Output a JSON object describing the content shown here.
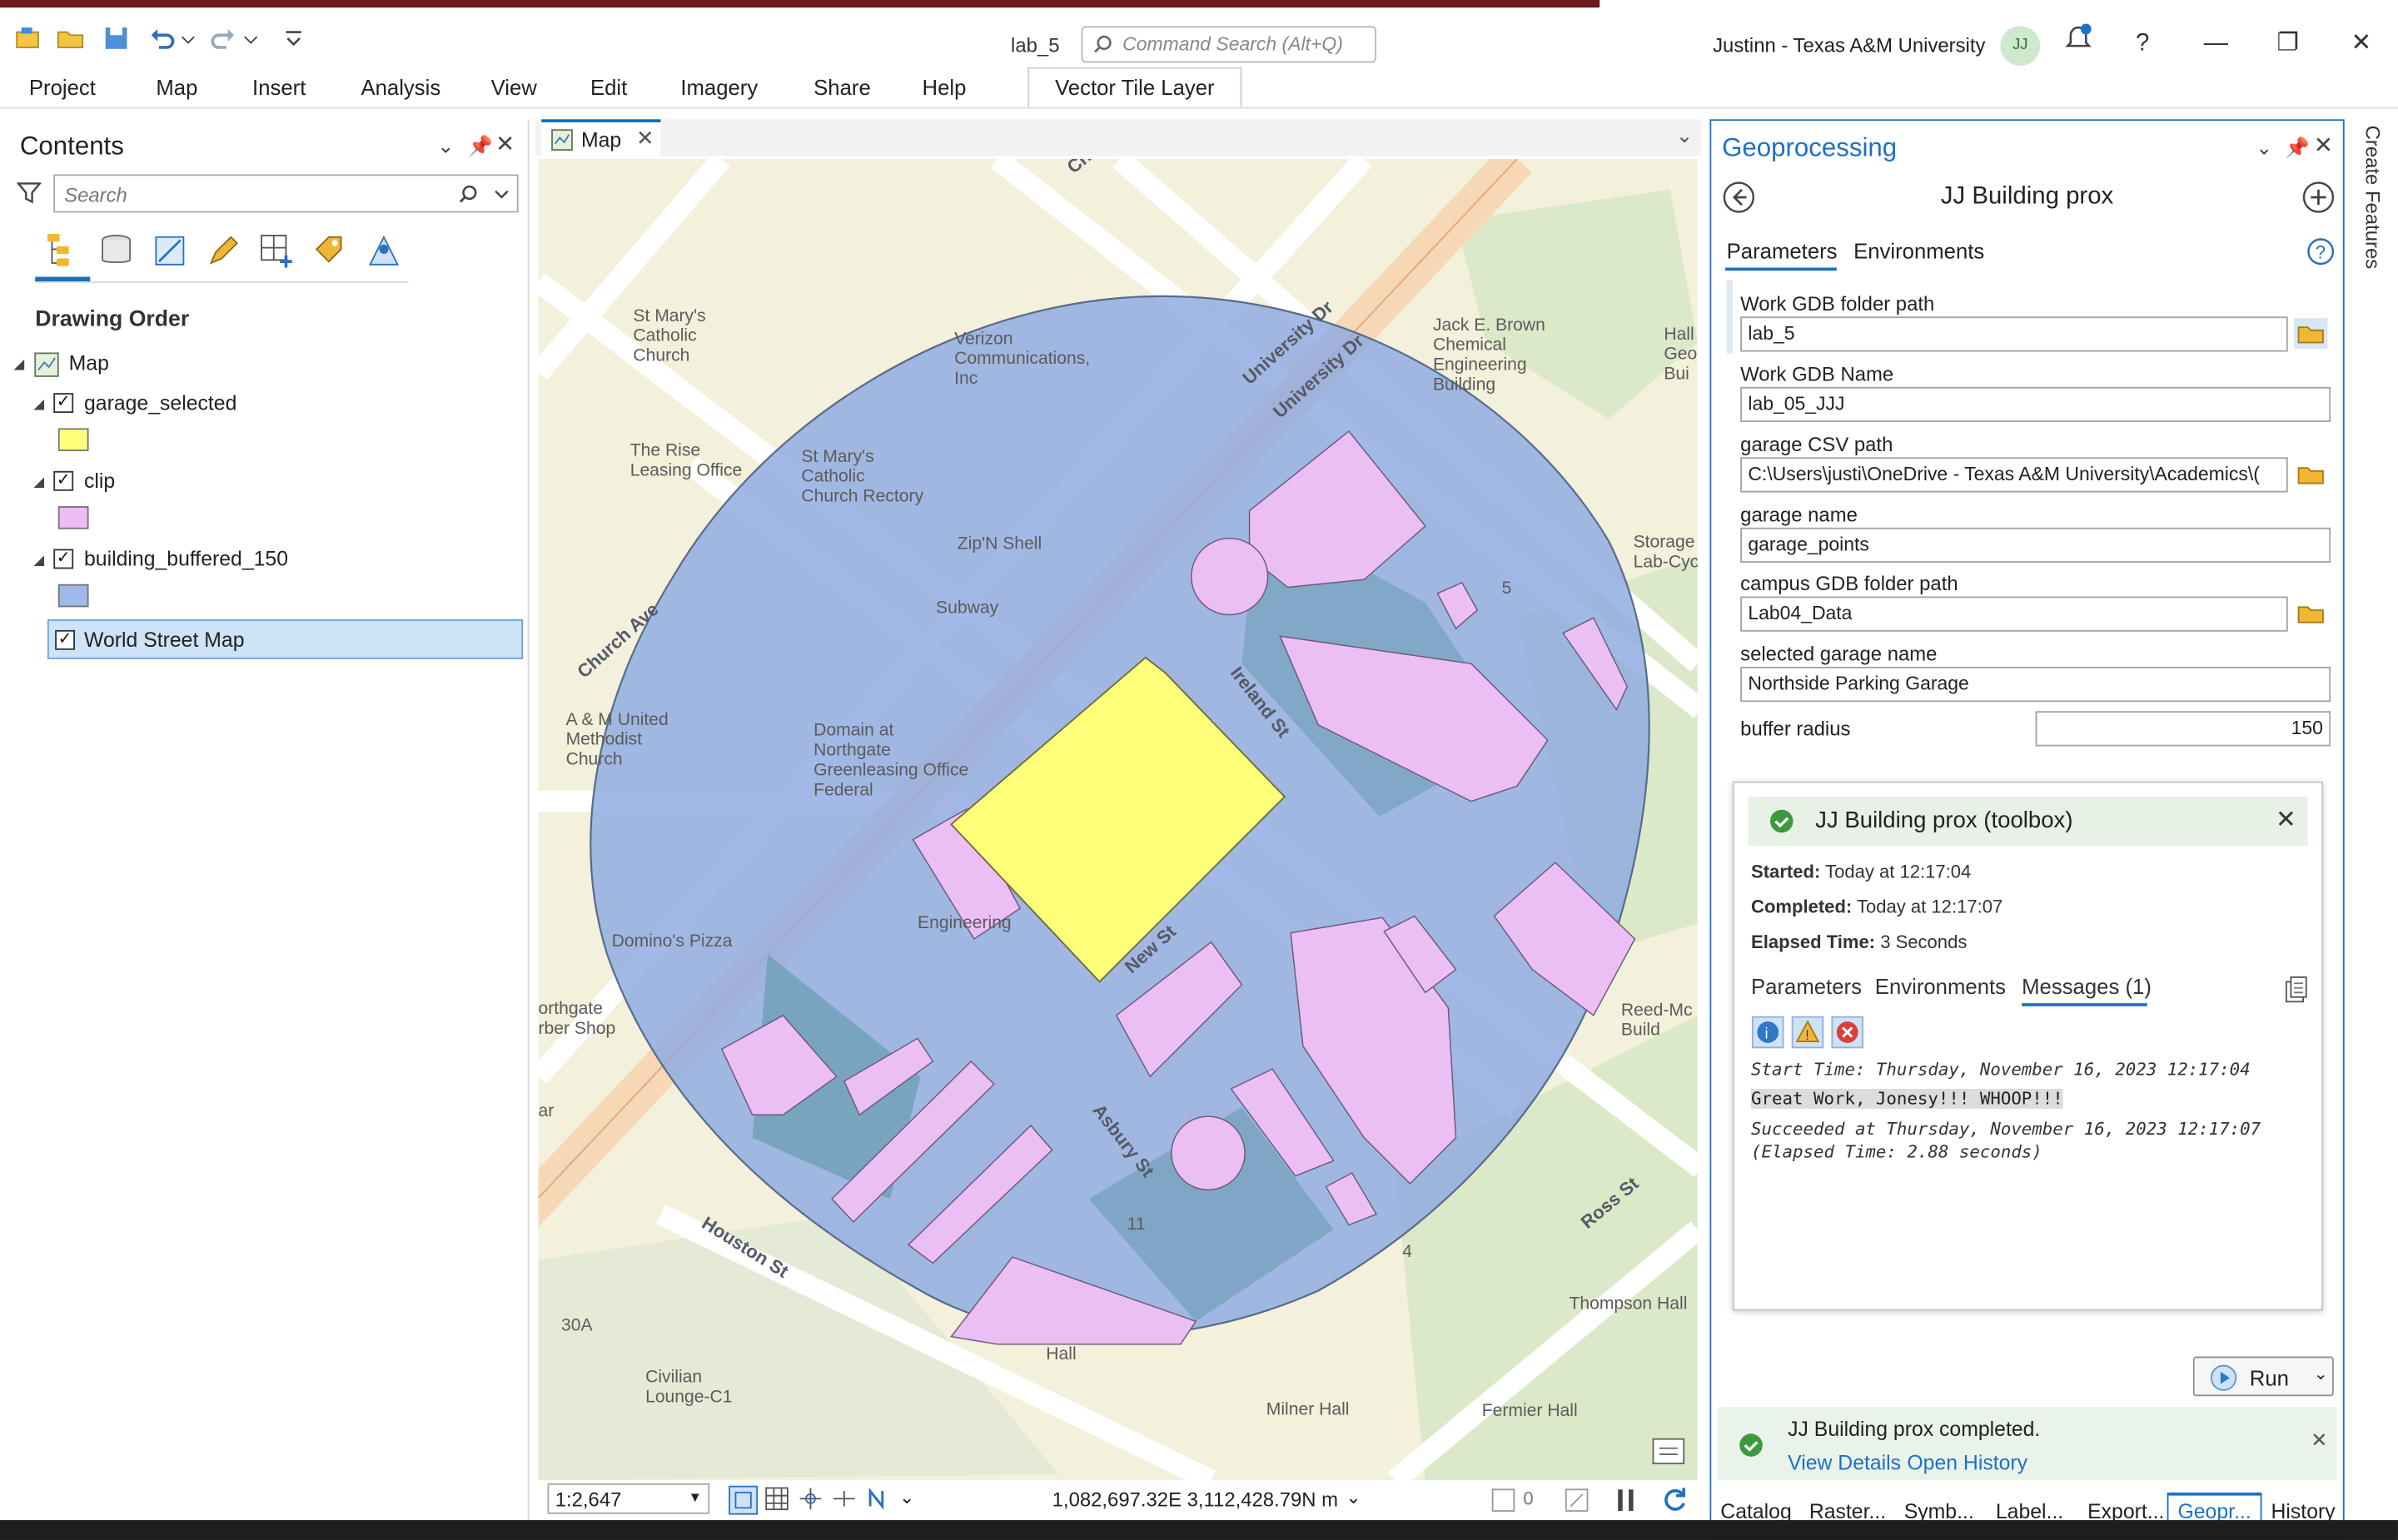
{
  "app": {
    "title": "lab_5",
    "command_search_placeholder": "Command Search (Alt+Q)",
    "user": "Justinn - Texas A&M University",
    "avatar_initials": "JJ",
    "accent": "#1d71c4"
  },
  "ribbon": {
    "tabs": [
      "Project",
      "Map",
      "Insert",
      "Analysis",
      "View",
      "Edit",
      "Imagery",
      "Share",
      "Help"
    ],
    "contextual_tab": "Vector Tile Layer"
  },
  "contents": {
    "title": "Contents",
    "search_placeholder": "Search",
    "section": "Drawing Order",
    "map_name": "Map",
    "layers": [
      {
        "name": "garage_selected",
        "checked": true,
        "swatch": "#ffff7a"
      },
      {
        "name": "clip",
        "checked": true,
        "swatch": "#eebcf4"
      },
      {
        "name": "building_buffered_150",
        "checked": true,
        "swatch": "#9fb9ea"
      }
    ],
    "basemap": {
      "name": "World Street Map",
      "checked": true,
      "selected": true
    }
  },
  "map": {
    "tab_label": "Map",
    "scale": "1:2,647",
    "coordinates": "1,082,697.32E 3,112,428.79N m",
    "selected_features": "0",
    "labels": {
      "st_marys_church": "St Mary's\nCatholic\nChurch",
      "verizon": "Verizon\nCommunications,\nInc",
      "jack_brown": "Jack E. Brown\nChemical\nEngineering\nBuilding",
      "rise_leasing": "The Rise\nLeasing Office",
      "st_marys_rectory": "St Mary's\nCatholic\nChurch Rectory",
      "zipn_shell": "Zip'N Shell",
      "subway": "Subway",
      "storage": "Storage\nLab-Cycl",
      "am_united": "A & M United\nMethodist\nChurch",
      "domain": "Domain at\nNorthgate\nGreenleasing Office\nFederal",
      "dominos": "Domino's Pizza",
      "northgate_barber": "orthgate\nrber Shop",
      "ar": "ar",
      "reed_mc": "Reed-Mc\nBuild",
      "houston_st": "Houston St",
      "church_ave": "Church Ave",
      "university_dr": "University Dr",
      "university_dr_2": "University Dr",
      "ireland_st": "Ireland St",
      "new_st": "New St",
      "asbury_st": "Asbury St",
      "ross_st": "Ross St",
      "thompson_hall": "Thompson Hall",
      "milner_hall": "Milner Hall",
      "fermier_hall": "Fermier Hall",
      "civilian_lounge": "Civilian\nLounge-C1",
      "label_30a": "30A",
      "label_11": "11",
      "label_4": "4",
      "label_5": "5",
      "hall": "Hall",
      "se_engineering": "Engineering",
      "chu": "Chu",
      "geos": "Hall\nGeos\nBui"
    }
  },
  "geoprocessing": {
    "title": "Geoprocessing",
    "tool_name": "JJ Building prox",
    "tabs": [
      "Parameters",
      "Environments"
    ],
    "params": [
      {
        "label": "Work GDB folder path",
        "value": "lab_5"
      },
      {
        "label": "Work GDB Name",
        "value": "lab_05_JJJ"
      },
      {
        "label": "garage CSV path",
        "value": "C:\\Users\\justi\\OneDrive - Texas A&M University\\Academics\\("
      },
      {
        "label": "garage name",
        "value": "garage_points"
      },
      {
        "label": "campus GDB folder path",
        "value": "Lab04_Data"
      },
      {
        "label": "selected garage name",
        "value": "Northside Parking Garage"
      },
      {
        "label": "buffer radius",
        "value": "150"
      }
    ],
    "result": {
      "title": "JJ Building prox (toolbox)",
      "started_label": "Started:",
      "started": "Today at 12:17:04",
      "completed_label": "Completed:",
      "completed": "Today at 12:17:07",
      "elapsed_label": "Elapsed Time:",
      "elapsed": "3 Seconds",
      "tabs": [
        "Parameters",
        "Environments",
        "Messages (1)"
      ],
      "messages": [
        "Start Time: Thursday, November 16, 2023 12:17:04",
        "Great Work, Jonesy!!! WHOOP!!!",
        "Succeeded at Thursday, November 16, 2023 12:17:07",
        "(Elapsed Time: 2.88 seconds)"
      ]
    },
    "run_label": "Run",
    "notification": "JJ Building prox completed.",
    "view_details": "View Details",
    "open_history": "Open History",
    "bottom_tabs": [
      "Catalog",
      "Raster...",
      "Symb...",
      "Label...",
      "Export...",
      "Geopr...",
      "History"
    ]
  },
  "side_strip": {
    "label": "Create Features"
  }
}
